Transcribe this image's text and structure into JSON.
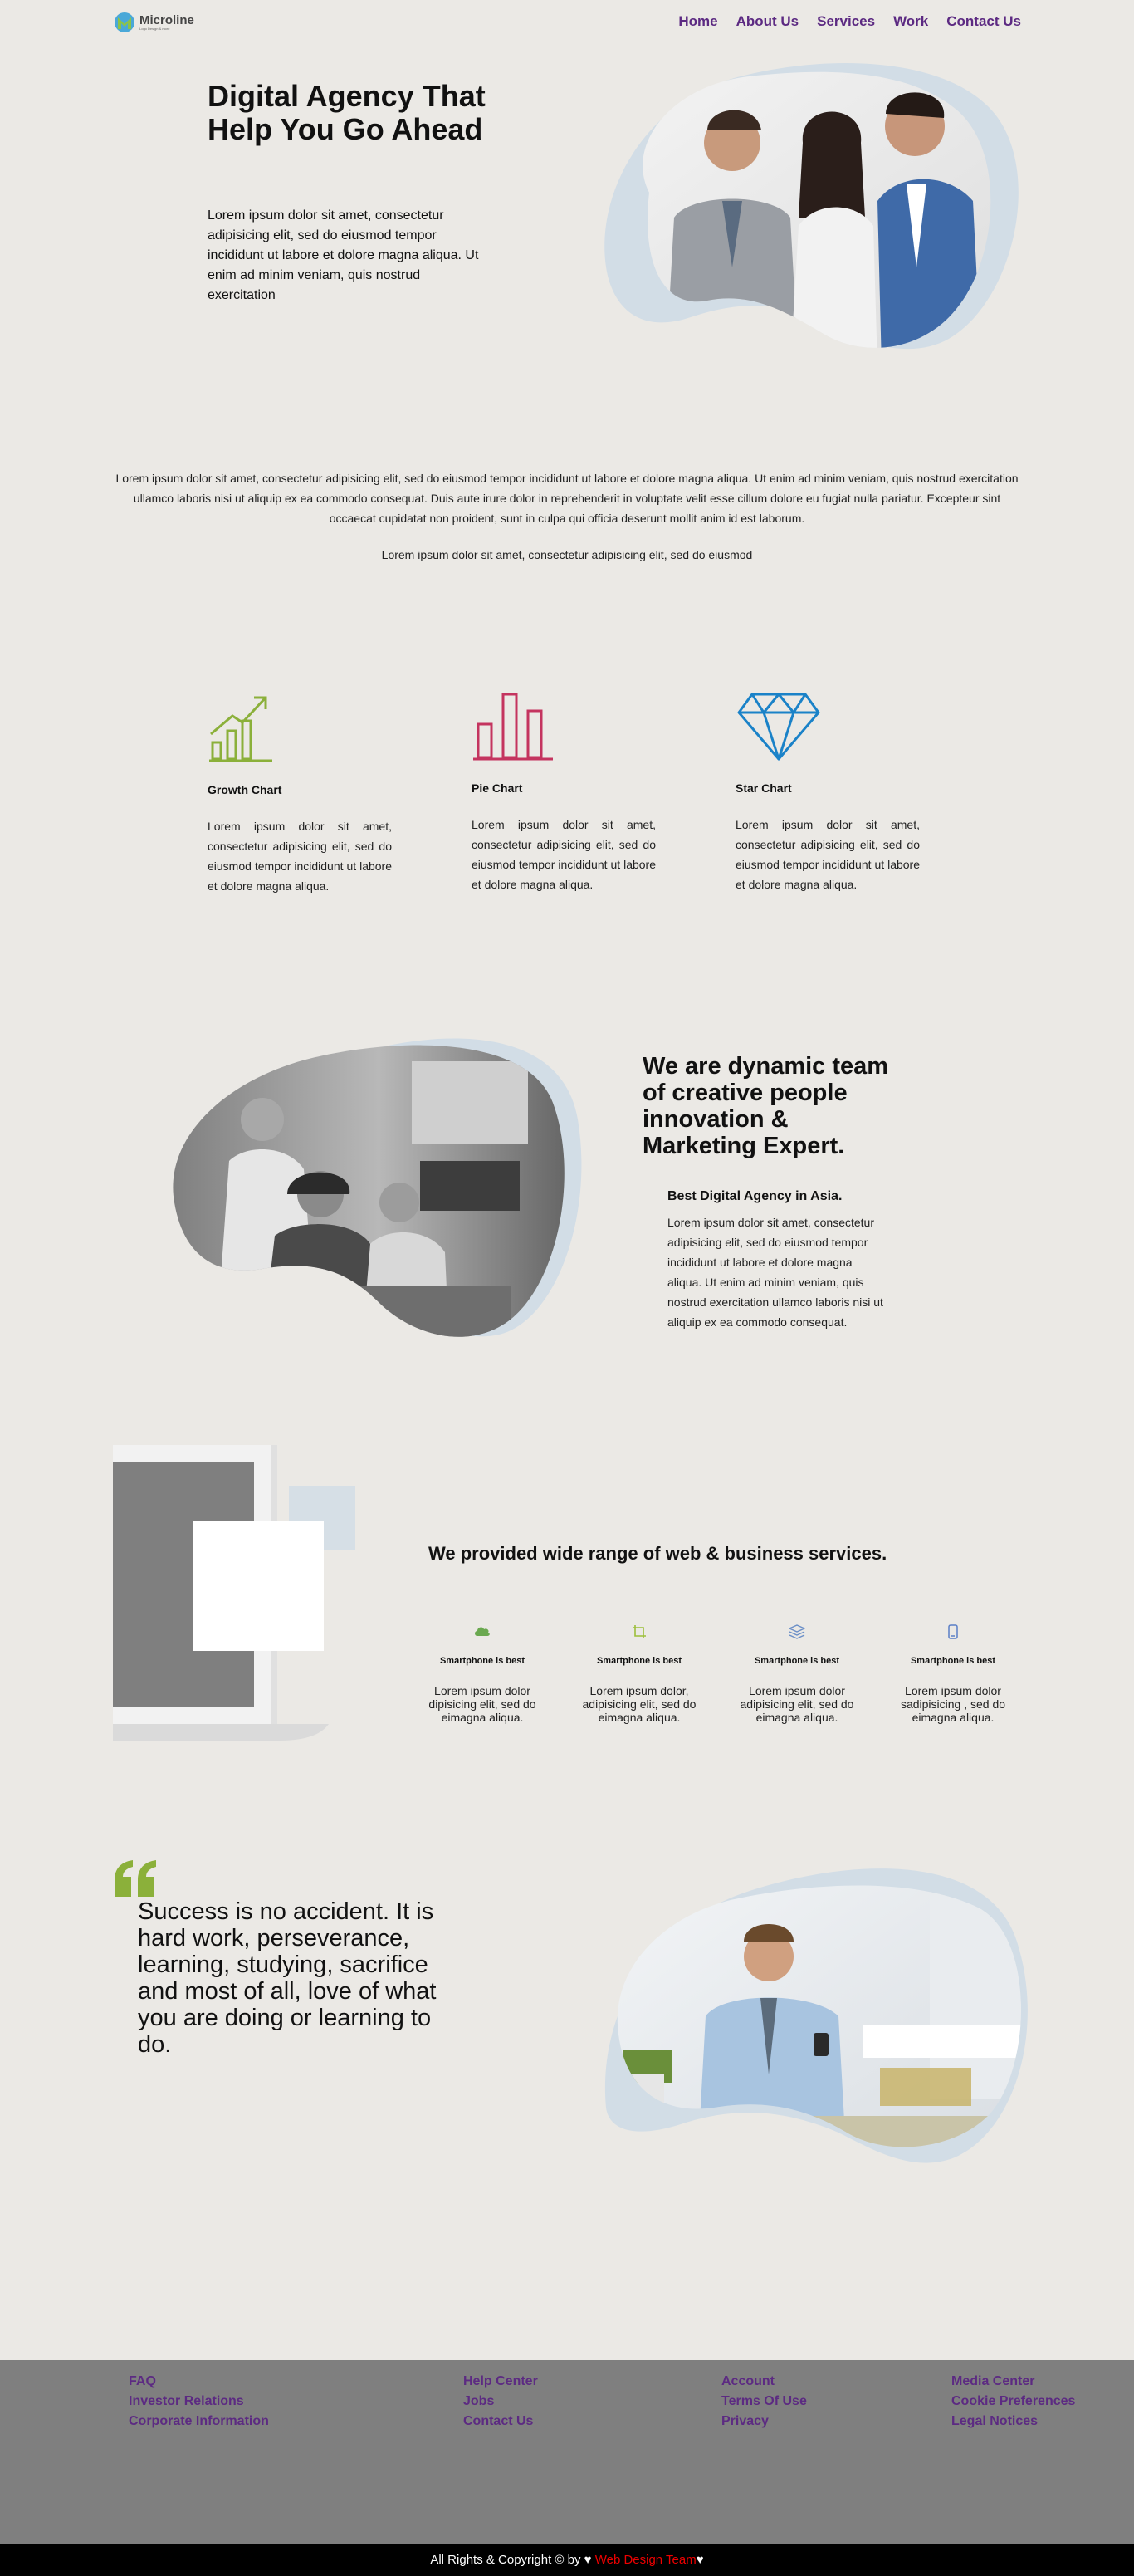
{
  "header": {
    "logo_name": "Microline",
    "logo_tagline": "Logo Design & more",
    "nav": [
      {
        "label": "Home"
      },
      {
        "label": "About Us"
      },
      {
        "label": "Services"
      },
      {
        "label": "Work"
      },
      {
        "label": "Contact Us"
      }
    ]
  },
  "hero": {
    "title": "Digital Agency That Help You Go Ahead",
    "text": "Lorem ipsum dolor sit amet, consectetur adipisicing elit, sed do eiusmod tempor incididunt ut labore et dolore magna aliqua. Ut enim ad minim veniam, quis nostrud exercitation"
  },
  "intro": {
    "paragraph": "Lorem ipsum dolor sit amet, consectetur adipisicing elit, sed do eiusmod tempor incididunt ut labore et dolore magna aliqua. Ut enim ad minim veniam, quis nostrud exercitation ullamco laboris nisi ut aliquip ex ea commodo consequat. Duis aute irure dolor in reprehenderit in voluptate velit esse cillum dolore eu fugiat nulla pariatur. Excepteur sint occaecat cupidatat non proident, sunt in culpa qui officia deserunt mollit anim id est laborum.",
    "line": "Lorem ipsum dolor sit amet, consectetur adipisicing elit, sed do eiusmod"
  },
  "features": [
    {
      "title": "Growth Chart",
      "text": "Lorem ipsum dolor sit amet, consectetur adipisicing elit, sed do eiusmod tempor incididunt ut labore et dolore magna aliqua.",
      "icon": "growth-chart-icon",
      "color": "#8bb03a"
    },
    {
      "title": "Pie Chart",
      "text": "Lorem ipsum dolor sit amet, consectetur adipisicing elit, sed do eiusmod tempor incididunt ut labore et dolore magna aliqua.",
      "icon": "bar-chart-icon",
      "color": "#c4345f"
    },
    {
      "title": "Star Chart",
      "text": "Lorem ipsum dolor sit amet, consectetur adipisicing elit, sed do eiusmod tempor incididunt ut labore et dolore magna aliqua.",
      "icon": "diamond-icon",
      "color": "#1a82c8"
    }
  ],
  "about": {
    "title": "We are dynamic team of creative people innovation & Marketing Expert.",
    "subtitle": "Best Digital Agency in Asia.",
    "text": "Lorem ipsum dolor sit amet, consectetur adipisicing elit, sed do eiusmod tempor incididunt ut labore et dolore magna aliqua. Ut enim ad minim veniam, quis nostrud exercitation ullamco laboris nisi ut aliquip ex ea commodo consequat."
  },
  "services": {
    "title": "We provided wide range of web & business services.",
    "items": [
      {
        "title": "Smartphone is best",
        "text": "Lorem ipsum dolor dipisicing elit, sed do eimagna aliqua.",
        "icon": "cloud-icon",
        "color": "#6aa84f"
      },
      {
        "title": "Smartphone is best",
        "text": "Lorem ipsum dolor, adipisicing elit, sed do eimagna aliqua.",
        "icon": "crop-icon",
        "color": "#9cbf3a"
      },
      {
        "title": "Smartphone is best",
        "text": "Lorem ipsum dolor adipisicing elit, sed do eimagna aliqua.",
        "icon": "layers-icon",
        "color": "#6b8fc7"
      },
      {
        "title": "Smartphone is best",
        "text": "Lorem ipsum dolor sadipisicing , sed do eimagna aliqua.",
        "icon": "phone-icon",
        "color": "#5b7fc7"
      }
    ]
  },
  "quote": {
    "text": "Success is no accident. It is hard work, perseverance, learning, studying, sacrifice and most of all, love of what you are doing or learning to do.",
    "mark_color": "#8bb03a"
  },
  "footer": {
    "col1": [
      "FAQ",
      "Investor Relations",
      "Corporate Information"
    ],
    "col2": [
      "Help Center",
      "Jobs",
      "Contact Us"
    ],
    "col3": [
      "Account",
      "Terms Of Use",
      "Privacy"
    ],
    "col4": [
      "Media Center",
      "Cookie Preferences",
      "Legal Notices"
    ],
    "copyright_prefix": "All Rights & Copyright © by ♥",
    "copyright_team": "Web Design Team",
    "copyright_suffix": "♥"
  },
  "colors": {
    "background": "#ebe9e5",
    "nav": "#5c2a82",
    "blob": "#d2dde6",
    "footer": "#7f7f7f"
  }
}
